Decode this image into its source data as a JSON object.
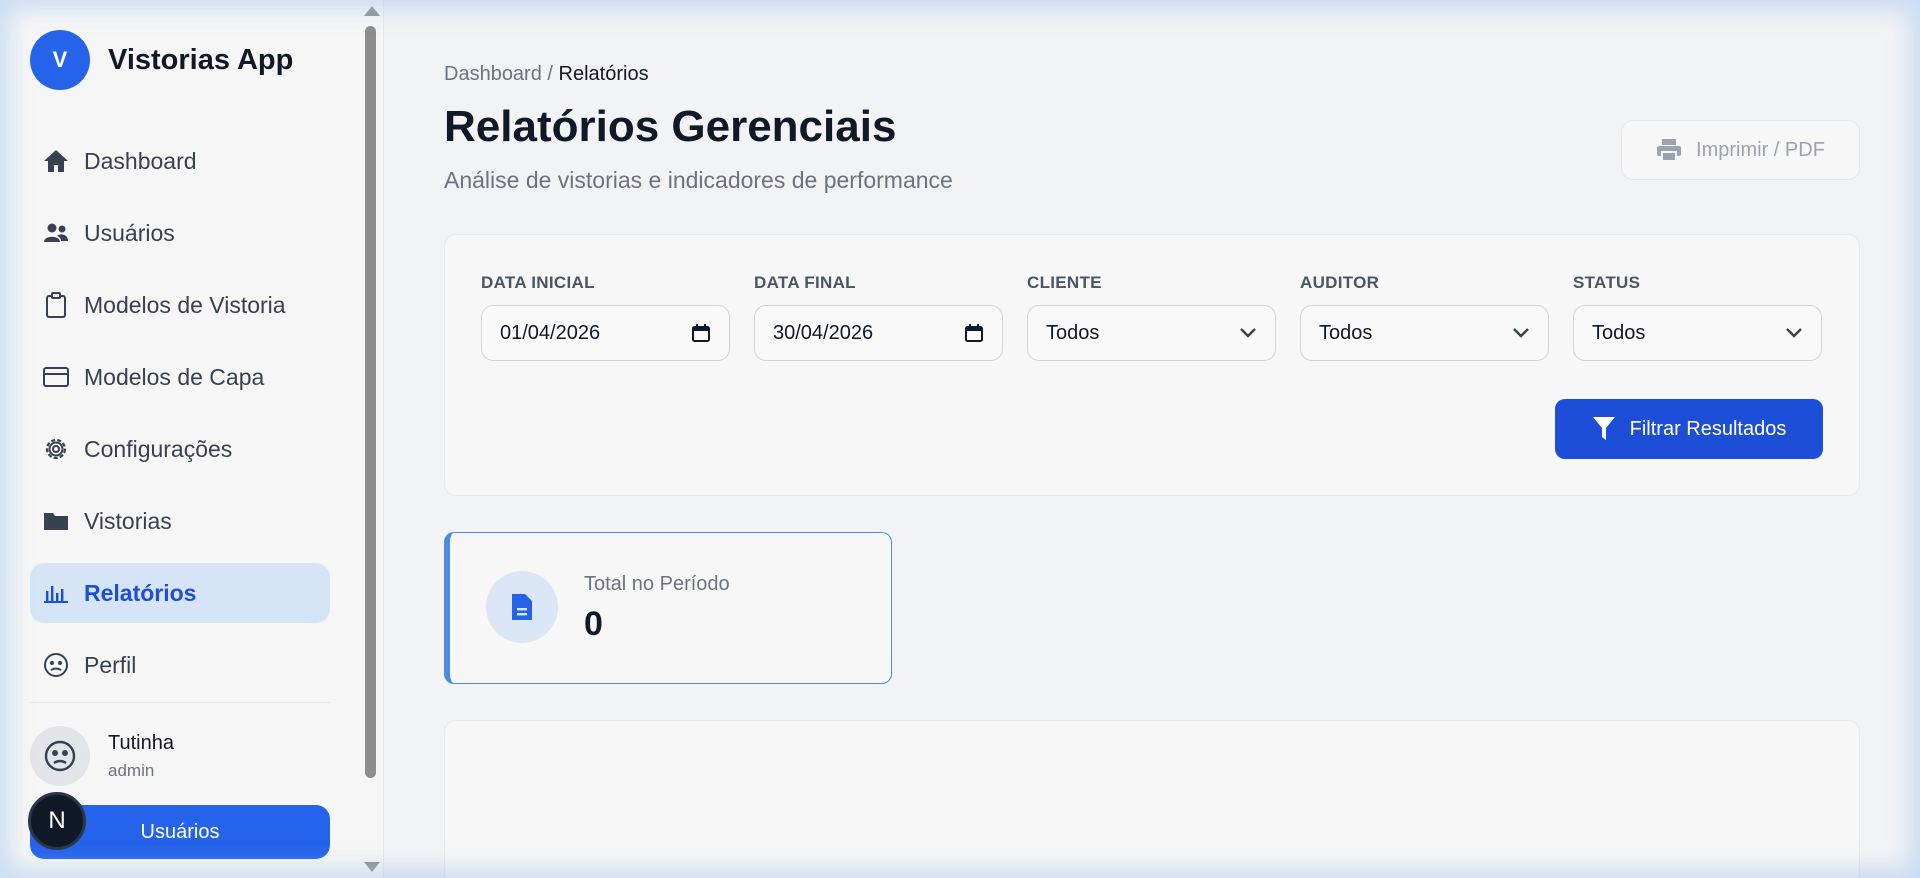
{
  "app": {
    "logo_letter": "V",
    "name": "Vistorias App"
  },
  "sidebar": {
    "items": [
      {
        "label": "Dashboard",
        "icon": "home-icon",
        "active": false
      },
      {
        "label": "Usuários",
        "icon": "users-icon",
        "active": false
      },
      {
        "label": "Modelos de Vistoria",
        "icon": "clipboard-icon",
        "active": false
      },
      {
        "label": "Modelos de Capa",
        "icon": "card-icon",
        "active": false
      },
      {
        "label": "Configurações",
        "icon": "gear-icon",
        "active": false
      },
      {
        "label": "Vistorias",
        "icon": "folder-icon",
        "active": false
      },
      {
        "label": "Relatórios",
        "icon": "bar-chart-icon",
        "active": true
      },
      {
        "label": "Perfil",
        "icon": "face-icon",
        "active": false
      }
    ],
    "user": {
      "name": "Tutinha",
      "role": "admin"
    },
    "bottom_button": "Usuários",
    "badge_letter": "N"
  },
  "breadcrumb": {
    "parent": "Dashboard",
    "separator": "/",
    "current": "Relatórios"
  },
  "header": {
    "title": "Relatórios Gerenciais",
    "subtitle": "Análise de vistorias e indicadores de performance",
    "print_label": "Imprimir / PDF"
  },
  "filters": {
    "start_date": {
      "label": "DATA INICIAL",
      "value": "01/04/2026"
    },
    "end_date": {
      "label": "DATA FINAL",
      "value": "30/04/2026"
    },
    "client": {
      "label": "CLIENTE",
      "value": "Todos"
    },
    "auditor": {
      "label": "AUDITOR",
      "value": "Todos"
    },
    "status": {
      "label": "STATUS",
      "value": "Todos"
    },
    "submit_label": "Filtrar Resultados"
  },
  "stats": {
    "total_label": "Total no Período",
    "total_value": "0"
  },
  "colors": {
    "primary": "#2563eb",
    "primary_dark": "#1d4ed8",
    "active_bg": "#d6e4f7",
    "card_border": "#4a8de0"
  }
}
